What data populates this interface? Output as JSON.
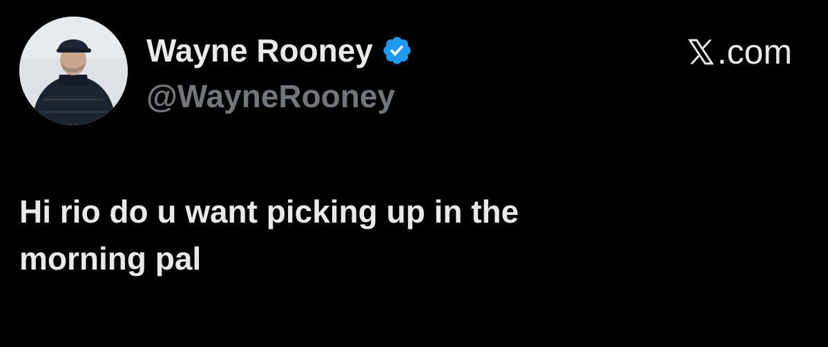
{
  "author": {
    "display_name": "Wayne Rooney",
    "handle": "@WayneRooney",
    "avatar": "profile-photo",
    "verified": true,
    "verified_icon": "verified-badge-icon"
  },
  "brand": {
    "icon": "x-logo-icon",
    "suffix": ".com"
  },
  "tweet": {
    "text": "Hi rio do u want picking up in the\nmorning pal"
  },
  "colors": {
    "background": "#000000",
    "primary_text": "#e7e9ea",
    "secondary_text": "#71767b",
    "verified_blue": "#1d9bf0"
  }
}
